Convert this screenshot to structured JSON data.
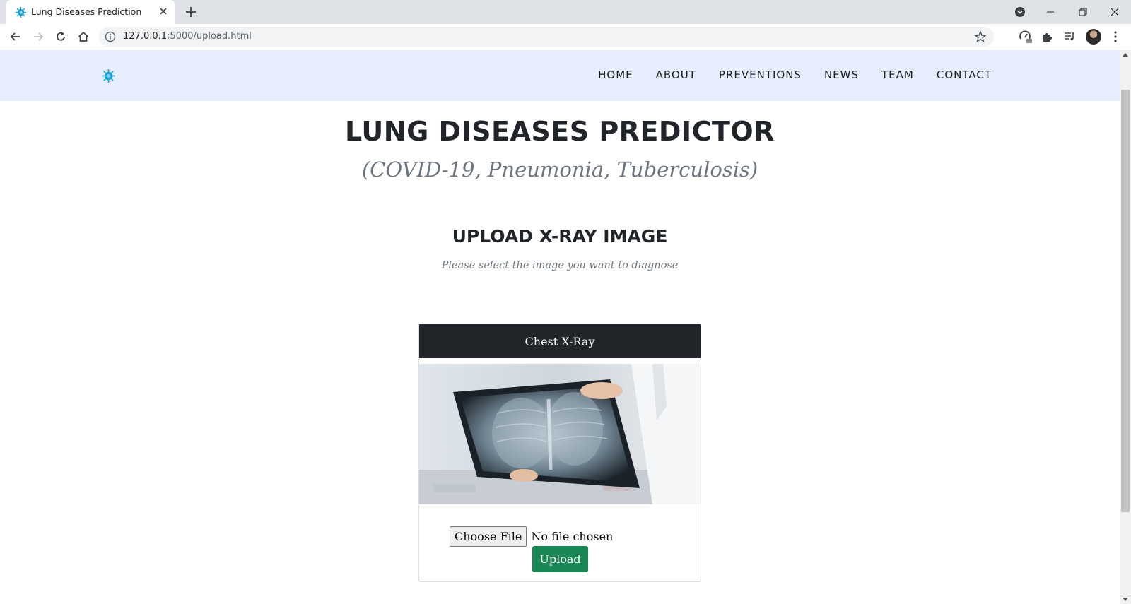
{
  "browser": {
    "tab_title": "Lung Diseases Prediction",
    "url_host": "127.0.0.1",
    "url_rest": ":5000/upload.html"
  },
  "site": {
    "nav": [
      "HOME",
      "ABOUT",
      "PREVENTIONS",
      "NEWS",
      "TEAM",
      "CONTACT"
    ],
    "title": "LUNG DISEASES PREDICTOR",
    "subtitle": "(COVID-19, Pneumonia, Tuberculosis)"
  },
  "upload": {
    "heading": "UPLOAD X-RAY IMAGE",
    "description": "Please select the image you want to diagnose",
    "card_title": "Chest X-Ray",
    "choose_file_label": "Choose File",
    "file_status": "No file chosen",
    "upload_label": "Upload"
  },
  "colors": {
    "header_bg": "#e6edff",
    "card_header_bg": "#212529",
    "upload_button": "#198754"
  }
}
